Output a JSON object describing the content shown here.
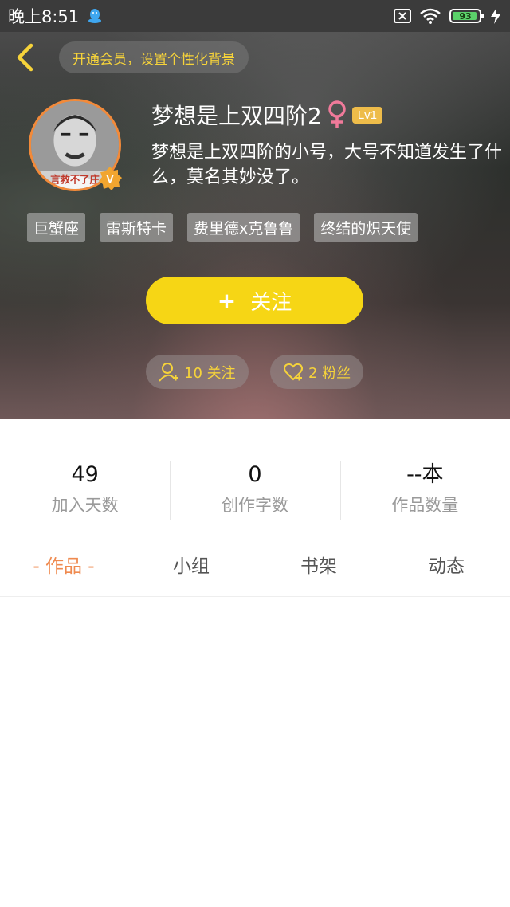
{
  "status_bar": {
    "time": "晚上8:51",
    "battery": "93",
    "icons": [
      "qq-icon",
      "notification-x-icon",
      "wifi-icon",
      "battery-icon",
      "charging-icon"
    ]
  },
  "header": {
    "vip_prompt": "开通会员，设置个性化背景"
  },
  "profile": {
    "name": "梦想是上双四阶2",
    "gender_symbol": "♀",
    "level": "Lv1",
    "verified_badge": "V",
    "avatar_caption": "言救不了庄",
    "bio": "梦想是上双四阶的小号，大号不知道发生了什么，莫名其妙没了。",
    "tags": [
      "巨蟹座",
      "雷斯特卡",
      "费里德x克鲁鲁",
      "终结的炽天使"
    ],
    "follow_button": {
      "plus": "+",
      "label": "关注"
    },
    "following_count": "10 关注",
    "fans_count": "2 粉丝"
  },
  "stats": [
    {
      "value": "49",
      "label": "加入天数"
    },
    {
      "value": "0",
      "label": "创作字数"
    },
    {
      "value": "--本",
      "label": "作品数量"
    }
  ],
  "tabs": [
    {
      "label": "- 作品 -",
      "active": true
    },
    {
      "label": "小组",
      "active": false
    },
    {
      "label": "书架",
      "active": false
    },
    {
      "label": "动态",
      "active": false
    }
  ],
  "colors": {
    "accent_yellow": "#f6d615",
    "active_tab": "#ef8a4f",
    "level_badge": "#eebc4a",
    "gender_icon": "#f07a9a"
  }
}
